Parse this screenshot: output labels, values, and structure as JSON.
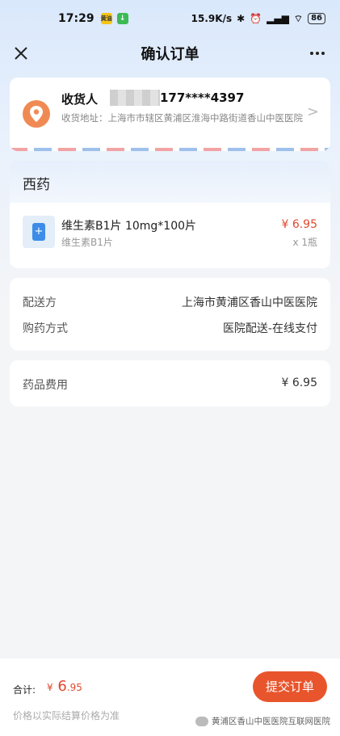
{
  "status_bar": {
    "time": "17:29",
    "badge_yellow": "黄油",
    "net_speed": "15.9K/s",
    "battery": "86"
  },
  "nav": {
    "title": "确认订单"
  },
  "address": {
    "receiver_label": "收货人",
    "phone": "177****4397",
    "line": "收货地址：上海市市辖区黄浦区淮海中路街道香山中医医院"
  },
  "medicine": {
    "section_title": "西药",
    "name": "维生素B1片  10mg*100片",
    "subtitle": "维生素B1片",
    "price": "¥ 6.95",
    "qty": "x 1瓶"
  },
  "delivery": {
    "provider_label": "配送方",
    "provider_value": "上海市黄浦区香山中医医院",
    "method_label": "购药方式",
    "method_value": "医院配送-在线支付"
  },
  "fee": {
    "label": "药品费用",
    "value": "¥ 6.95"
  },
  "bottom": {
    "total_label": "合计:",
    "total_currency": "¥",
    "total_int": "6",
    "total_dec": ".95",
    "note": "价格以实际结算价格为准",
    "submit_label": "提交订单",
    "watermark": "黄浦区香山中医医院互联网医院"
  },
  "colors": {
    "accent": "#e8552d",
    "price": "#e0492f",
    "location_pin": "#f08a54"
  }
}
